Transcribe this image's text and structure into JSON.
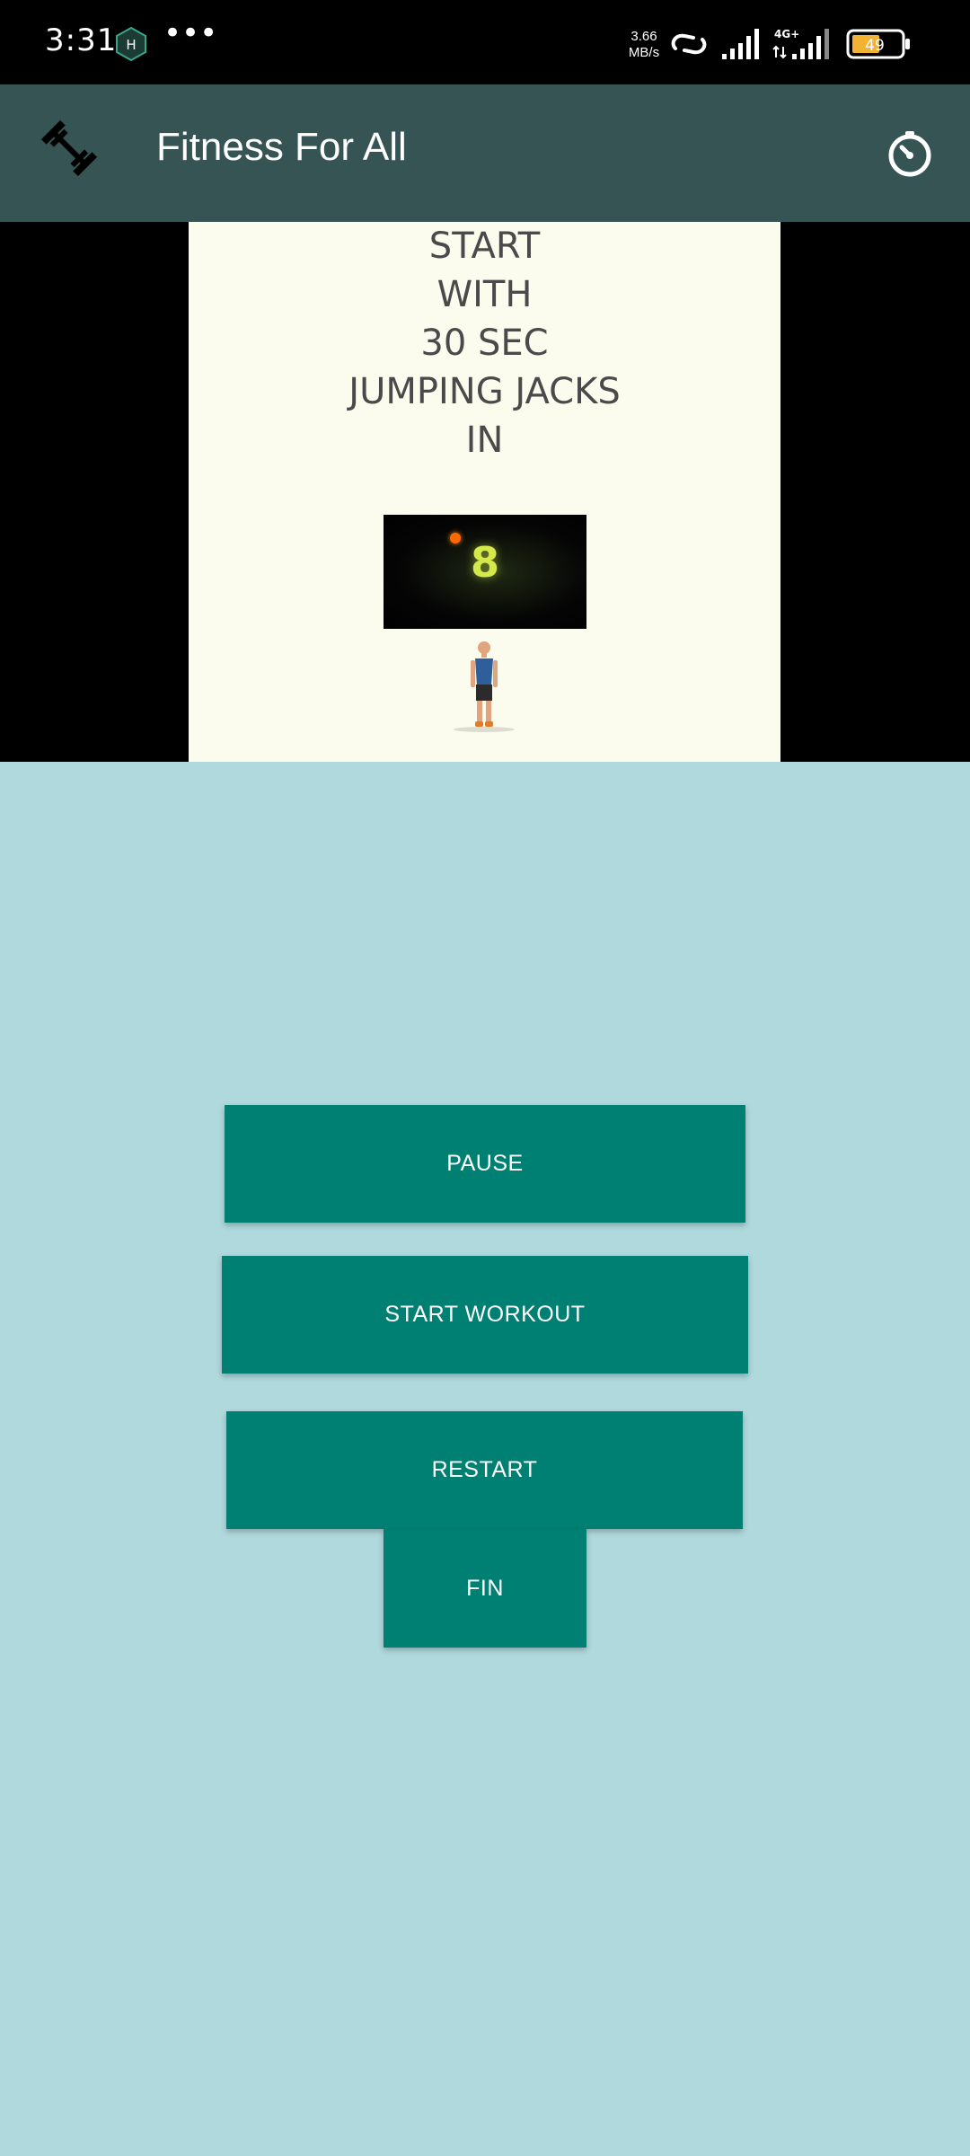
{
  "status_bar": {
    "time": "3:31",
    "speed_value": "3.66",
    "speed_unit": "MB/s",
    "network": "4G+",
    "battery": "49"
  },
  "app_bar": {
    "title": "Fitness For All"
  },
  "instructions": {
    "lines": [
      "START",
      "WITH",
      "30 SEC",
      "JUMPING JACKS",
      "IN"
    ]
  },
  "countdown": {
    "value": "8"
  },
  "buttons": {
    "pause": "PAUSE",
    "start_workout": "START WORKOUT",
    "restart": "RESTART",
    "fin": "FIN"
  },
  "colors": {
    "status_bar": "#000000",
    "app_bar": "#365454",
    "page_background": "#b0d9dd",
    "media_panel": "#fbfbee",
    "button": "#007f73",
    "countdown_digit": "#d6e94a"
  },
  "icons": {
    "app_logo": "dumbbell-icon",
    "app_action": "timer-icon"
  }
}
